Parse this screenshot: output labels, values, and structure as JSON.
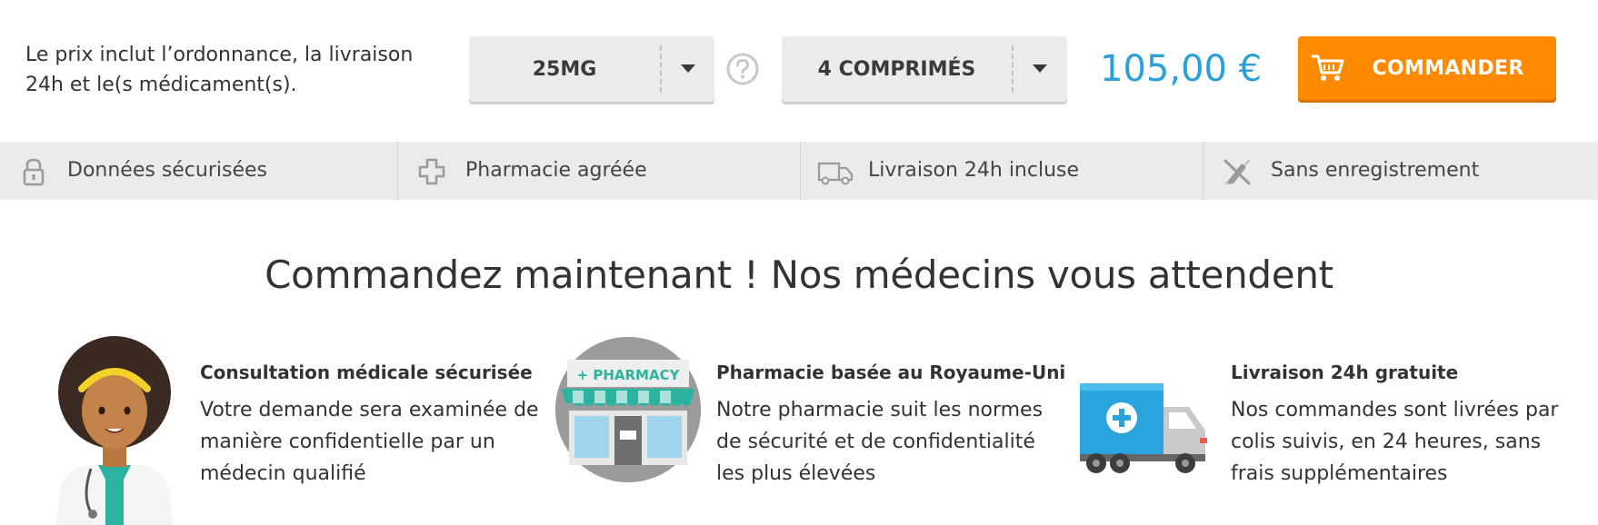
{
  "order": {
    "price_note": "Le prix inclut l’ordonnance, la livraison 24h et le(s médicament(s).",
    "dose_value": "25MG",
    "quantity_value": "4 COMPRIMÉS",
    "price": "105,00 €",
    "order_button_label": "COMMANDER",
    "icons": [
      "chevron-down-icon",
      "help-icon",
      "cart-icon"
    ]
  },
  "features": [
    {
      "label": "Données sécurisées",
      "icon": "lock-icon"
    },
    {
      "label": "Pharmacie agréée",
      "icon": "medical-cross-icon"
    },
    {
      "label": "Livraison 24h incluse",
      "icon": "delivery-van-icon"
    },
    {
      "label": "Sans enregistrement",
      "icon": "no-signup-icon"
    }
  ],
  "headline": "Commandez maintenant ! Nos médecins vous attendent",
  "benefits": [
    {
      "title": "Consultation médicale sécurisée",
      "text": "Votre demande sera examinée de manière confidentielle par un médecin qualifié",
      "icon": "doctor-illustration"
    },
    {
      "title": "Pharmacie basée au Royaume-Uni",
      "text": "Notre pharmacie suit les normes de sécurité et de confidentialité les plus élevées",
      "icon": "pharmacy-illustration",
      "sign_text": "+ PHARMACY"
    },
    {
      "title": "Livraison 24h gratuite",
      "text": "Nos commandes sont livrées par colis suivis, en 24 heures, sans frais supplémentaires",
      "icon": "truck-illustration"
    }
  ],
  "colors": {
    "accent_blue": "#2a9fd8",
    "order_orange": "#ff8a00",
    "strip_gray": "#ebebeb"
  }
}
